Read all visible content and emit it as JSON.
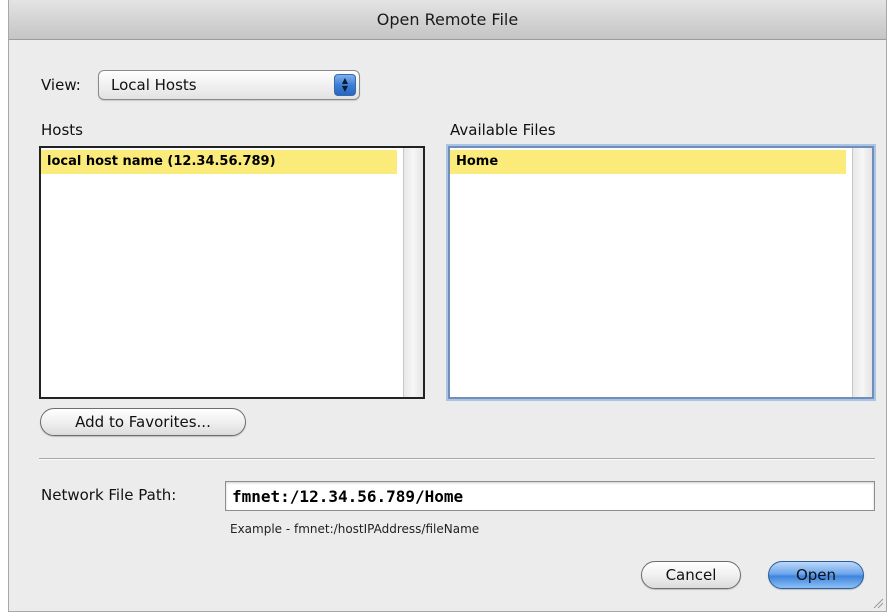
{
  "dialog": {
    "title": "Open Remote File"
  },
  "view": {
    "label": "View:",
    "selected": "Local Hosts",
    "stepper_glyph": "▲▼"
  },
  "hosts": {
    "label": "Hosts",
    "items": [
      {
        "label": "local host name (12.34.56.789)",
        "selected": true
      }
    ]
  },
  "files": {
    "label": "Available Files",
    "items": [
      {
        "label": "Home",
        "selected": true
      }
    ]
  },
  "buttons": {
    "add_favorites": "Add to Favorites...",
    "cancel": "Cancel",
    "open": "Open"
  },
  "path": {
    "label": "Network File Path:",
    "value": "fmnet:/12.34.56.789/Home",
    "example": "Example - fmnet:/hostIPAddress/fileName"
  },
  "colors": {
    "selection_highlight": "#fbeb7a",
    "default_button": "#3f84dd",
    "focus_ring": "#a9c4e6"
  }
}
